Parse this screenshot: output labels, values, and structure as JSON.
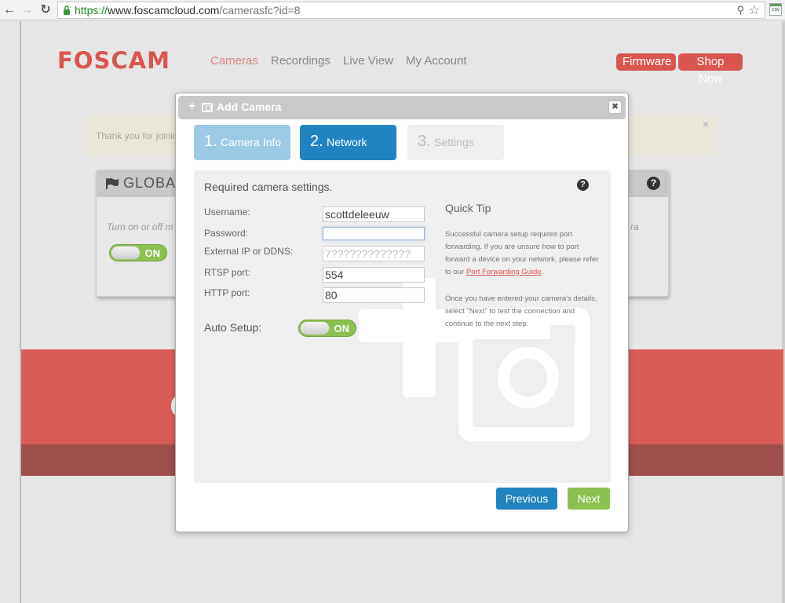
{
  "browser": {
    "url_scheme": "https://",
    "url_host": "www.foscamcloud.com",
    "url_path": "/camerasfc?id=8",
    "extension_label": "CSV"
  },
  "header": {
    "logo": "FOSCAM",
    "nav": [
      {
        "label": "Cameras",
        "active": true
      },
      {
        "label": "Recordings",
        "active": false
      },
      {
        "label": "Live View",
        "active": false
      },
      {
        "label": "My Account",
        "active": false
      }
    ],
    "firmware_label": "Firmware",
    "shop_label": "Shop Now"
  },
  "notice": {
    "text": "Thank you for joining",
    "close": "×"
  },
  "global_card": {
    "title": "GLOBAL",
    "description": "Turn on or off m",
    "description_right": "ra",
    "toggle_label": "ON",
    "toggle_on": true,
    "help": "?"
  },
  "modal": {
    "title": "Add Camera",
    "plus_glyph": "+",
    "close": "✖",
    "steps": [
      {
        "num": "1.",
        "label": "Camera Info",
        "state": "done"
      },
      {
        "num": "2.",
        "label": "Network",
        "state": "active"
      },
      {
        "num": "3.",
        "label": "Settings",
        "state": "pending"
      }
    ],
    "panel_title": "Required camera settings.",
    "help": "?",
    "fields": [
      {
        "label": "Username:",
        "value": "scottdeleeuw"
      },
      {
        "label": "Password:",
        "value": ""
      },
      {
        "label": "External IP or DDNS:",
        "value": "7?????????????"
      },
      {
        "label": "RTSP port:",
        "value": "554"
      },
      {
        "label": "HTTP port:",
        "value": "80"
      }
    ],
    "auto_setup_label": "Auto Setup:",
    "auto_setup_toggle": "ON",
    "auto_setup_on": true,
    "tip": {
      "title": "Quick Tip",
      "para1_before": "Successful camera setup requires port forwarding. If you are unsure how to port forward a device on your network, please refer to our ",
      "para1_link": "Port Forwarding Guide",
      "para1_after": ".",
      "para2": "Once you have entered your camera's details, select \"Next\" to test the connection and continue to the next step."
    },
    "previous_label": "Previous",
    "next_label": "Next"
  },
  "colors": {
    "brand_red": "#d95550",
    "primary_blue": "#2184c0",
    "success_green": "#8cc152",
    "band_red": "#d95d56",
    "band_dark_red": "#9f4f4c"
  }
}
